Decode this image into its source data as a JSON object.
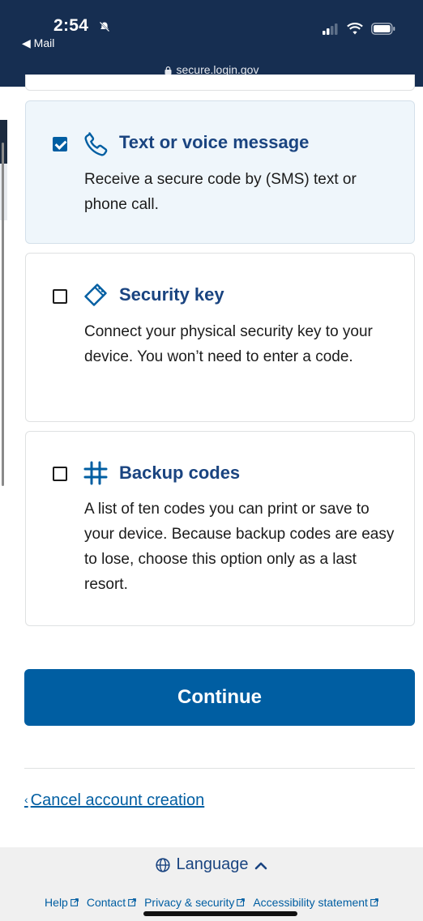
{
  "status_bar": {
    "time": "2:54",
    "back_app": "◀ Mail",
    "url": "secure.login.gov"
  },
  "options": [
    {
      "title": "Text or voice message",
      "description": "Receive a secure code by (SMS) text or phone call.",
      "checked": true,
      "icon": "phone-icon"
    },
    {
      "title": "Security key",
      "description": "Connect your physical security key to your device. You won’t need to enter a code.",
      "checked": false,
      "icon": "security-key-icon"
    },
    {
      "title": "Backup codes",
      "description": "A list of ten codes you can print or save to your device. Because backup codes are easy to lose, choose this option only as a last resort.",
      "checked": false,
      "icon": "hash-icon"
    }
  ],
  "continue_label": "Continue",
  "cancel_label": "Cancel account creation",
  "footer": {
    "language_label": "Language",
    "links": [
      "Help",
      "Contact",
      "Privacy & security",
      "Accessibility statement"
    ]
  },
  "colors": {
    "header_bg": "#162e51",
    "primary": "#005ea2",
    "primary_dark": "#1a4480",
    "selected_card_bg": "#eff6fb"
  }
}
